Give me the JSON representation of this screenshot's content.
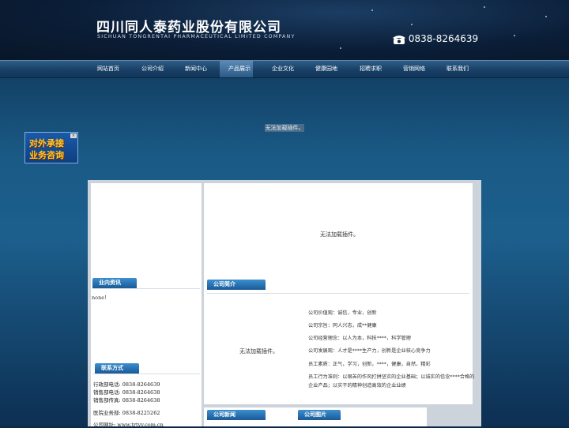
{
  "header": {
    "company_cn": "四川同人泰药业股份有限公司",
    "company_en": "SICHUAN TONGRENTAI PHARMACEUTICAL LIMITED COMPANY",
    "phone": "0838-8264639"
  },
  "nav": {
    "items": [
      "网站首页",
      "公司介绍",
      "新闻中心",
      "产品展示",
      "企业文化",
      "健康园地",
      "招聘求职",
      "营销网络",
      "联系我们"
    ],
    "active_index": 3
  },
  "banner": {
    "plugin_notice": "无法加载插件。"
  },
  "consult_ad": {
    "line1": "对外承接",
    "line2": "业务咨询",
    "close": "×"
  },
  "left": {
    "industry_title": "业内资讯",
    "industry_content": "none!",
    "contact_title": "联系方式",
    "contacts": [
      {
        "label": "行政部电话:",
        "value": "0838-8264639"
      },
      {
        "label": "销售部电话:",
        "value": "0838-8264638"
      },
      {
        "label": "销售部传真:",
        "value": "0838-8264638"
      },
      {
        "label": "医院业务部:",
        "value": "0838-8225262"
      },
      {
        "label": "公司网址:",
        "value": "www.trtyy.com.cn"
      }
    ]
  },
  "right": {
    "plugin_notice": "无法加载插件。",
    "intro_title": "公司简介",
    "intro_plugin_notice": "无法加载插件。",
    "values": [
      "公司价值观：诚信，专业，创新",
      "公司宗旨：同人兴志，成**健康",
      "公司经营理念：以人为本，科技****，科学管理",
      "公司发展观：人才是****生产力，创新是企业核心竞争力",
      "员工素质：正气，学习，创新，****，健康，自然，精彩",
      "员工行为准则：以艰苦的作风打拼坚实的企业基础；以诚实的信念****合格的",
      "企业产品；以实干的精神创造高效的企业业绩"
    ],
    "news_title": "公司新闻",
    "photos_title": "公司图片"
  },
  "colors": {
    "nav_bg": "#173e64",
    "section_title": "#1a5a96",
    "ad_text": "#ffcc33"
  }
}
